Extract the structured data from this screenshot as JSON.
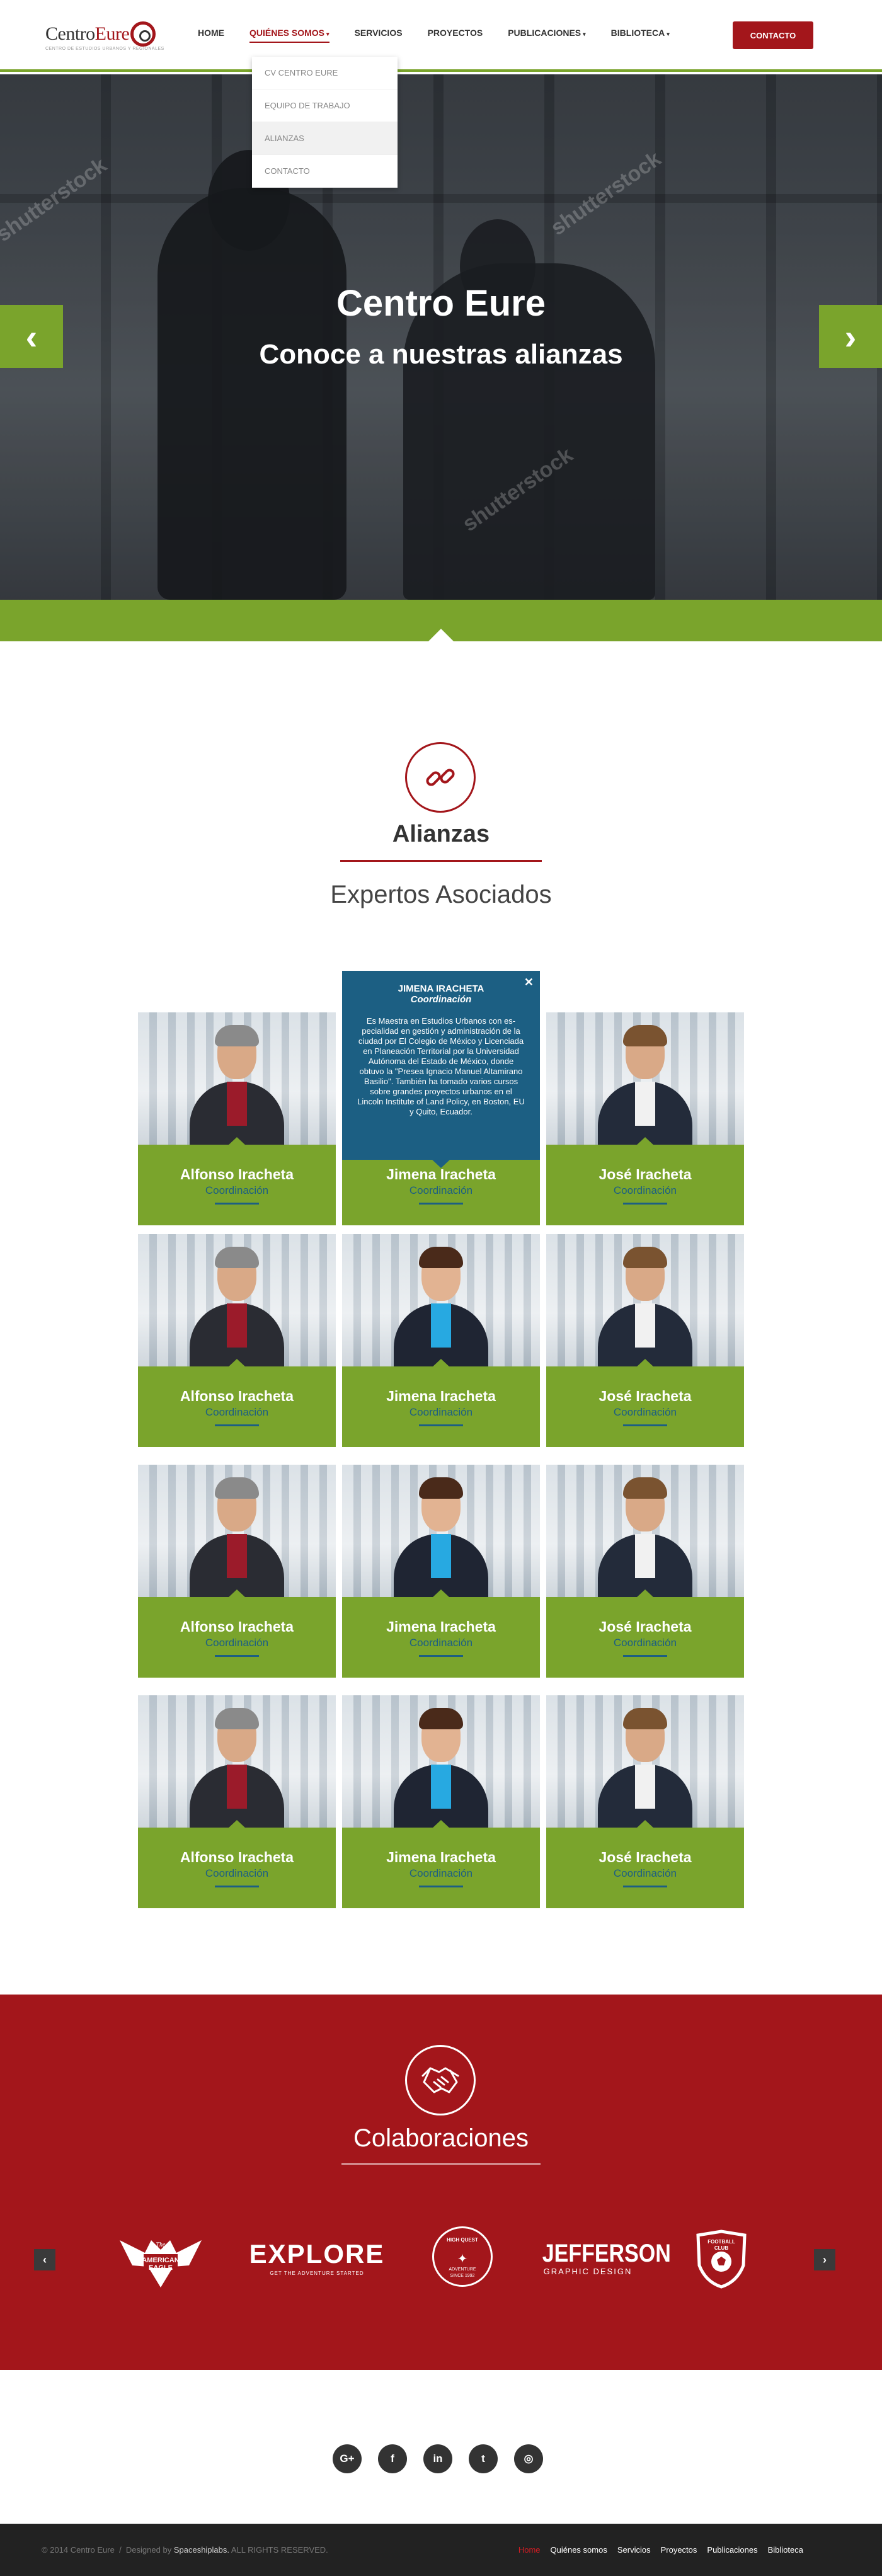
{
  "brand": {
    "logo_prefix": "Centro",
    "logo_suffix": "Eure",
    "tagline": "CENTRO DE ESTUDIOS URBANOS Y REGIONALES"
  },
  "nav": {
    "items": [
      {
        "label": "HOME"
      },
      {
        "label": "QUIÉNES SOMOS",
        "active": true,
        "caret": "▾"
      },
      {
        "label": "SERVICIOS"
      },
      {
        "label": "PROYECTOS"
      },
      {
        "label": "PUBLICACIONES",
        "caret": "▾"
      },
      {
        "label": "BIBLIOTECA",
        "caret": "▾"
      }
    ],
    "contact_label": "CONTACTO"
  },
  "dropdown": {
    "items": [
      "CV CENTRO EURE",
      "EQUIPO DE TRABAJO",
      "ALIANZAS",
      "CONTACTO"
    ],
    "highlighted_index": 2
  },
  "hero": {
    "title": "Centro Eure",
    "subtitle": "Conoce a nuestras alianzas",
    "prev_label": "‹",
    "next_label": "›",
    "watermark": "shutterstock"
  },
  "alianzas": {
    "title": "Alianzas",
    "subtitle": "Expertos Asociados"
  },
  "tooltip": {
    "name": "JIMENA IRACHETA",
    "role": "Coordinación",
    "text": "Es Maestra en Estudios Urbanos con es-pecialidad en gestión y administración de la ciudad por El Colegio de México y Licenciada en Planeación Territorial por la Universidad Autónoma del Estado de México, donde obtuvo la \"Presea Ignacio Manuel Altamirano Basilio\". También ha tomado varios cursos sobre grandes proyectos urbanos en el Lincoln Institute of Land Policy, en Boston, EU y Quito, Ecuador.",
    "close": "✕"
  },
  "team": {
    "rows": [
      [
        {
          "name": "Alfonso Iracheta",
          "role": "Coordinación"
        },
        {
          "name": "Jimena Iracheta",
          "role": "Coordinación"
        },
        {
          "name": "José Iracheta",
          "role": "Coordinación"
        }
      ],
      [
        {
          "name": "Alfonso Iracheta",
          "role": "Coordinación"
        },
        {
          "name": "Jimena Iracheta",
          "role": "Coordinación"
        },
        {
          "name": "José Iracheta",
          "role": "Coordinación"
        }
      ],
      [
        {
          "name": "Alfonso Iracheta",
          "role": "Coordinación"
        },
        {
          "name": "Jimena Iracheta",
          "role": "Coordinación"
        },
        {
          "name": "José Iracheta",
          "role": "Coordinación"
        }
      ],
      [
        {
          "name": "Alfonso Iracheta",
          "role": "Coordinación"
        },
        {
          "name": "Jimena Iracheta",
          "role": "Coordinación"
        },
        {
          "name": "José Iracheta",
          "role": "Coordinación"
        }
      ]
    ]
  },
  "collab": {
    "title": "Colaboraciones",
    "prev": "‹",
    "next": "›",
    "logos": [
      {
        "line1": "The",
        "line2": "AMERICAN",
        "line3": "EAGLE"
      },
      {
        "line1": "EXPLORE",
        "line2": "GET THE ADVENTURE STARTED"
      },
      {
        "line1": "HIGH QUEST",
        "line2": "ADVENTURE",
        "line3": "SINCE 1992"
      },
      {
        "line1": "JEFFERSON",
        "line2": "GRAPHIC DESIGN"
      },
      {
        "line1": "FOOTBALL",
        "line2": "CLUB"
      }
    ]
  },
  "social": {
    "items": [
      {
        "icon": "google-plus-icon",
        "glyph": "G+"
      },
      {
        "icon": "facebook-icon",
        "glyph": "f"
      },
      {
        "icon": "linkedin-icon",
        "glyph": "in"
      },
      {
        "icon": "twitter-icon",
        "glyph": "t"
      },
      {
        "icon": "instagram-icon",
        "glyph": "◎"
      }
    ]
  },
  "footer": {
    "copyright": "© 2014 Centro Eure",
    "separator": "/",
    "designed_by": "Designed by",
    "designer": "Spaceshiplabs.",
    "rights": "ALL RIGHTS RESERVED.",
    "links": [
      "Home",
      "Quiénes somos",
      "Servicios",
      "Proyectos",
      "Publicaciones",
      "Biblioteca"
    ]
  },
  "colors": {
    "brand_red": "#a3161b",
    "brand_green": "#7aa42c",
    "brand_blue": "#1c5f83"
  }
}
